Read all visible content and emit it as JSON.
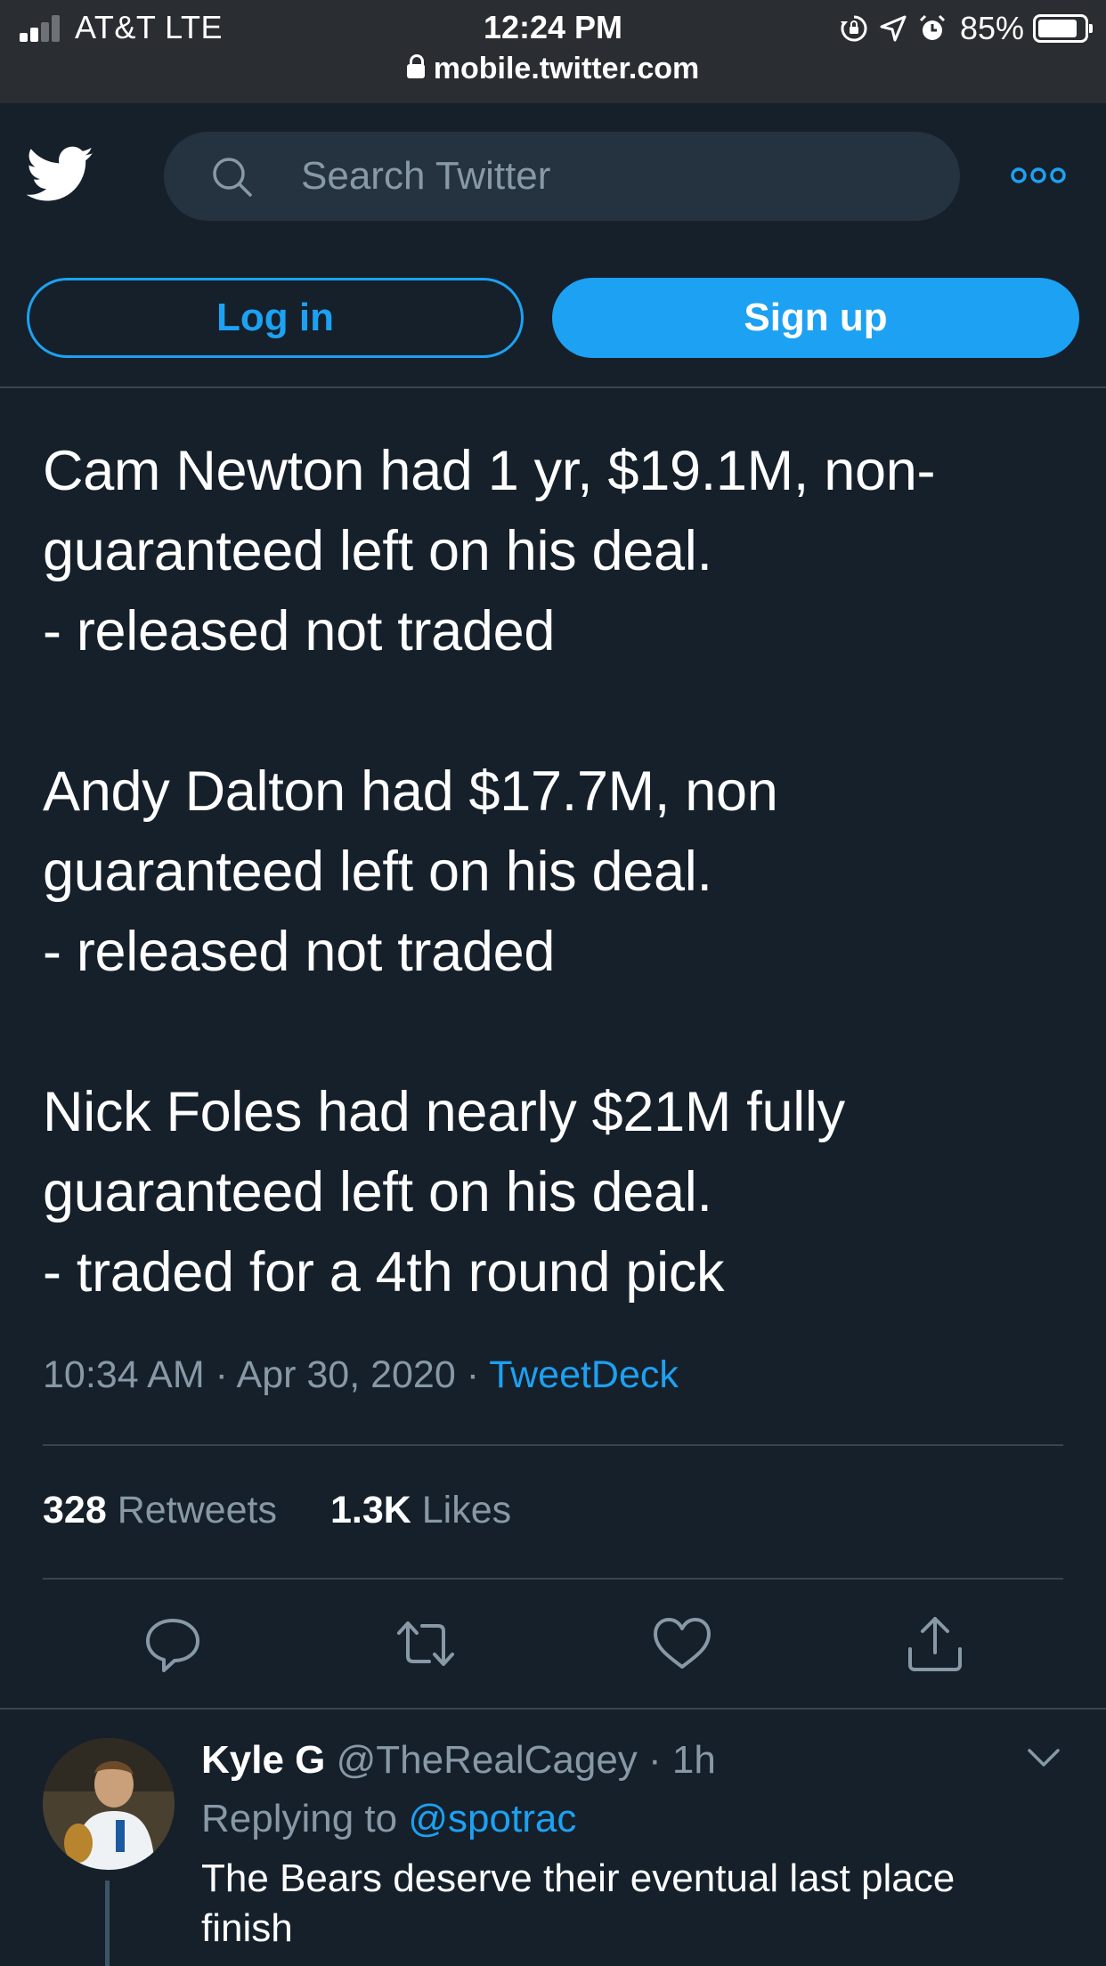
{
  "status_bar": {
    "carrier": "AT&T  LTE",
    "time": "12:24 PM",
    "url": "mobile.twitter.com",
    "battery_percent": "85%",
    "battery_level": 0.85,
    "icons": [
      "signal-icon",
      "orientation-lock-icon",
      "location-icon",
      "alarm-icon",
      "battery-icon",
      "lock-icon"
    ]
  },
  "header": {
    "logo": "twitter-bird-icon",
    "search_placeholder": "Search Twitter",
    "more_icon": "more-icon",
    "login_label": "Log in",
    "signup_label": "Sign up"
  },
  "tweet": {
    "paragraphs": [
      [
        "Cam Newton had 1 yr, $19.1M, non-",
        "guaranteed left on his deal.",
        "- released not traded"
      ],
      [
        "Andy Dalton had $17.7M, non",
        "guaranteed left on his deal.",
        "- released not traded"
      ],
      [
        "Nick Foles had nearly $21M fully",
        "guaranteed left on his deal.",
        "- traded for a 4th round pick"
      ]
    ],
    "meta_time": "10:34 AM · Apr 30, 2020 · ",
    "source": "TweetDeck",
    "retweets_count": "328",
    "retweets_label": "Retweets",
    "likes_count": "1.3K",
    "likes_label": "Likes",
    "actions": [
      "reply-icon",
      "retweet-icon",
      "like-icon",
      "share-icon"
    ]
  },
  "reply": {
    "name": "Kyle G",
    "handle": "@TheRealCagey",
    "time": "1h",
    "replying_prefix": "Replying to ",
    "replying_to": "@spotrac",
    "text": "The Bears deserve their eventual last place finish"
  },
  "colors": {
    "background": "#15202b",
    "status_bar": "#2a2d31",
    "accent": "#1da1f2",
    "secondary_text": "#8899a6",
    "divider": "#38444d",
    "search_bg": "#253341"
  }
}
